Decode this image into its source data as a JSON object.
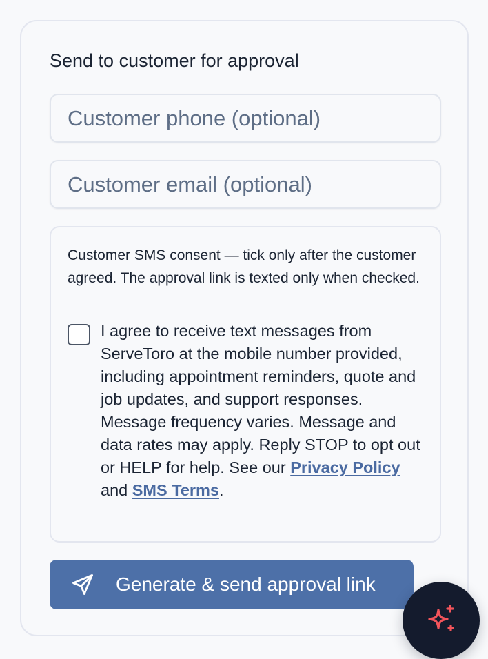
{
  "card": {
    "title": "Send to customer for approval"
  },
  "phone_field": {
    "placeholder": "Customer phone (optional)",
    "value": ""
  },
  "email_field": {
    "placeholder": "Customer email (optional)",
    "value": ""
  },
  "consent": {
    "note": "Customer SMS consent — tick only after the customer agreed. The approval link is texted only when checked.",
    "checked": false,
    "agree_text_before": "I agree to receive text messages from ServeToro at the mobile number provided, including appointment reminders, quote and job updates, and support responses. Message frequency varies. Message and data rates may apply. Reply STOP to opt out or HELP for help. See our ",
    "privacy_link": "Privacy Policy",
    "agree_text_and": " and ",
    "sms_terms_link": "SMS Terms",
    "agree_text_after": "."
  },
  "send_button": {
    "label": "Generate & send approval link",
    "icon": "send-icon"
  },
  "assistant_fab": {
    "icon": "sparkles-icon"
  },
  "colors": {
    "primary": "#4d70a8",
    "link": "#4a6aa1",
    "fab_background": "#141b2d",
    "fab_icon": "#f2545b",
    "text": "#1b2433",
    "placeholder": "#5e6e86",
    "border": "#e3e6ef"
  }
}
